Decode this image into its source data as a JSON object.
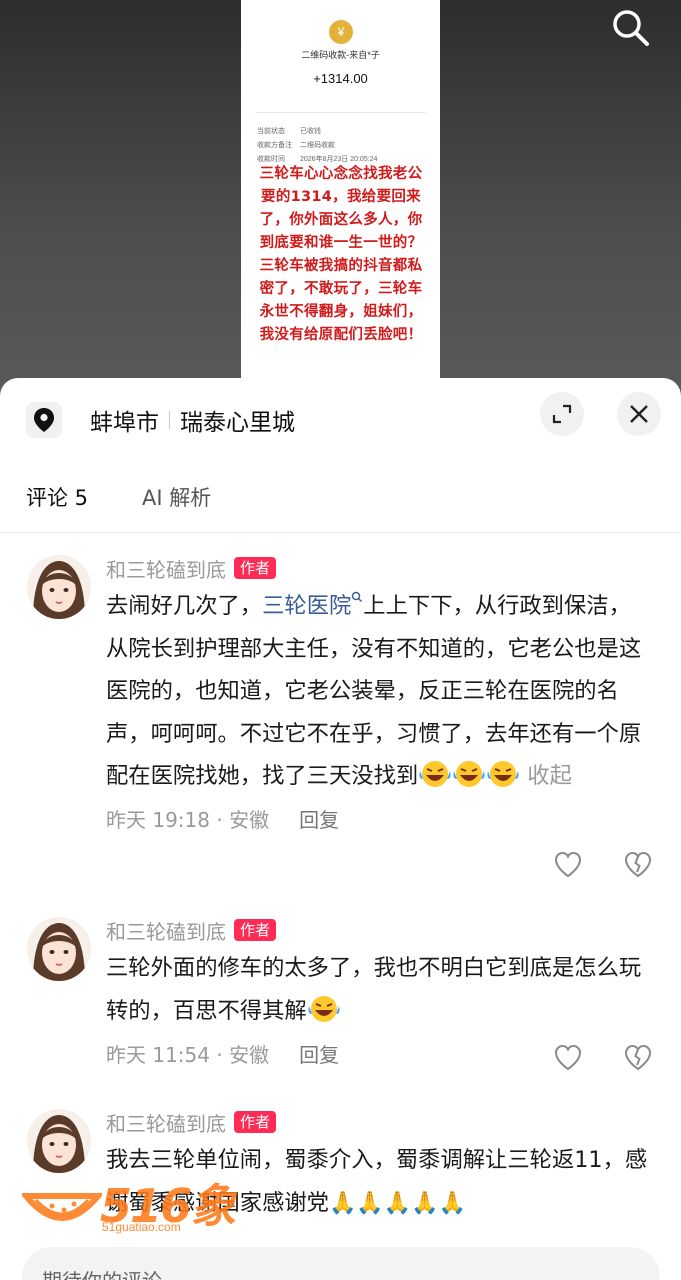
{
  "receipt": {
    "coin_icon": "coin-icon",
    "qr_line": "二维码收款-来自*子",
    "amount": "+1314.00",
    "rows": [
      {
        "k": "当前状态",
        "v": "已收钱"
      },
      {
        "k": "收款方备注",
        "v": "二维码收款"
      },
      {
        "k": "收款时间",
        "v": "2026年8月23日 20:05:24"
      }
    ],
    "overlay_text": "三轮车心心念念找我老公要的1314，我给要回来了，你外面这么多人，你到底要和谁一生一世的？三轮车被我搞的抖音都私密了，不敢玩了，三轮车永世不得翻身，姐妹们，我没有给原配们丢脸吧！"
  },
  "location": {
    "city": "蚌埠市",
    "place": "瑞泰心里城"
  },
  "tabs": [
    {
      "label": "评论 5"
    },
    {
      "label": "AI 解析"
    }
  ],
  "comments": [
    {
      "user": "和三轮磕到底",
      "badge": "作者",
      "text_before": "去闹好几次了，",
      "link": "三轮医院",
      "text_after": "上上下下，从行政到保洁，从院长到护理部大主任，没有不知道的，它老公也是这医院的，也知道，它老公装晕，反正三轮在医院的名声，呵呵呵。不过它不在乎，习惯了，去年还有一个原配在医院找她，找了三天没找到",
      "collapse": "收起",
      "time": "昨天 19:18 · 安徽",
      "reply": "回复"
    },
    {
      "user": "和三轮磕到底",
      "badge": "作者",
      "text_before": "三轮外面的修车的太多了，我也不明白它到底是怎么玩转的，百思不得其解",
      "time": "昨天 11:54 · 安徽",
      "reply": "回复"
    },
    {
      "user": "和三轮磕到底",
      "badge": "作者",
      "text_before": "我去三轮单位闹，蜀黍介入，蜀黍调解让三轮返11，感谢蜀黍感谢国家感谢党"
    }
  ],
  "input": {
    "placeholder": "期待你的评论"
  },
  "watermark": {
    "brand": "516象",
    "url": "51guatiao.com"
  },
  "colors": {
    "badge": "#fe2c55",
    "link": "#3b5c9c",
    "overlay_text": "#d11b1b",
    "watermark": "#ff7a1a"
  }
}
